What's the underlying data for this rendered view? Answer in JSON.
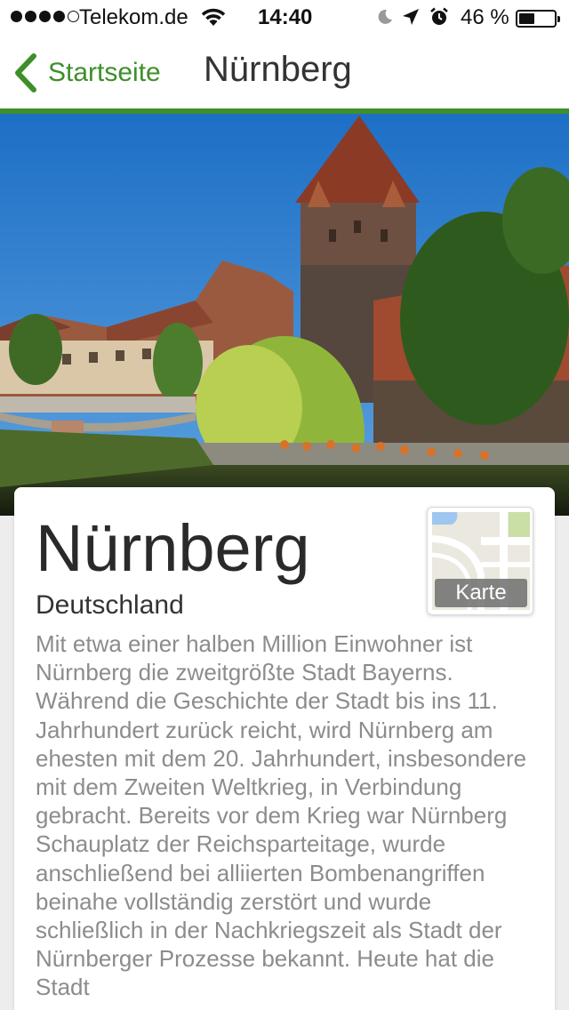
{
  "status_bar": {
    "carrier": "Telekom.de",
    "time": "14:40",
    "battery_percent_text": "46 %",
    "battery_level": 0.46,
    "signal_bars_filled": 4,
    "signal_bars_total": 5
  },
  "nav": {
    "back_label": "Startseite",
    "title": "Nürnberg"
  },
  "city": {
    "name": "Nürnberg",
    "country": "Deutschland",
    "map_label": "Karte",
    "description": "Mit etwa einer halben Million Einwohner ist Nürnberg die zweitgrößte Stadt Bayerns. Während die Geschichte der Stadt bis ins 11. Jahrhundert zurück reicht, wird Nürnberg am ehesten mit dem 20. Jahrhundert, insbesondere mit dem Zweiten Weltkrieg, in Verbindung gebracht. Bereits vor dem Krieg war Nürnberg Schauplatz der Reichsparteitage, wurde anschließend bei alliierten Bombenangriffen beinahe vollständig zerstört und wurde schließlich in der Nachkriegszeit als Stadt der Nürnberger Prozesse bekannt. Heute hat die Stadt"
  },
  "icons": {
    "wifi": "wifi-icon",
    "moon": "do-not-disturb-icon",
    "location": "location-arrow-icon",
    "alarm": "alarm-clock-icon",
    "back": "chevron-left-icon"
  },
  "colors": {
    "accent": "#3e8f2a",
    "card_background": "#ffffff",
    "page_background": "#ededed",
    "description_text": "#8c8c8c"
  }
}
